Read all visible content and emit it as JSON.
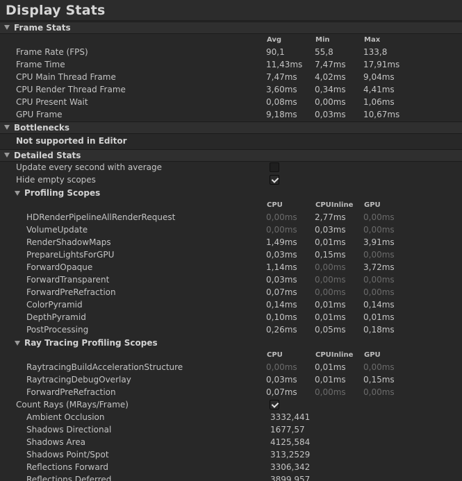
{
  "window_title": "Display Stats",
  "frame_stats": {
    "header": "Frame Stats",
    "columns": [
      "Avg",
      "Min",
      "Max"
    ],
    "rows": [
      {
        "name": "Frame Rate (FPS)",
        "avg": "90,1",
        "min": "55,8",
        "max": "133,8"
      },
      {
        "name": "Frame Time",
        "avg": "11,43ms",
        "min": "7,47ms",
        "max": "17,91ms"
      },
      {
        "name": "CPU Main Thread Frame",
        "avg": "7,47ms",
        "min": "4,02ms",
        "max": "9,04ms"
      },
      {
        "name": "CPU Render Thread Frame",
        "avg": "3,60ms",
        "min": "0,34ms",
        "max": "4,41ms"
      },
      {
        "name": "CPU Present Wait",
        "avg": "0,08ms",
        "min": "0,00ms",
        "max": "1,06ms"
      },
      {
        "name": "GPU Frame",
        "avg": "9,18ms",
        "min": "0,03ms",
        "max": "10,67ms"
      }
    ]
  },
  "bottlenecks": {
    "header": "Bottlenecks",
    "message": "Not supported in Editor"
  },
  "detailed_stats": {
    "header": "Detailed Stats",
    "update_every_second": {
      "label": "Update every second with average",
      "checked": false
    },
    "hide_empty_scopes": {
      "label": "Hide empty scopes",
      "checked": true
    },
    "profiling_scopes": {
      "header": "Profiling Scopes",
      "columns": [
        "CPU",
        "CPUInline",
        "GPU"
      ],
      "rows": [
        {
          "name": "HDRenderPipelineAllRenderRequest",
          "cpu": "0,00ms",
          "cpuinline": "2,77ms",
          "gpu": "0,00ms"
        },
        {
          "name": "VolumeUpdate",
          "cpu": "0,00ms",
          "cpuinline": "0,03ms",
          "gpu": "0,00ms"
        },
        {
          "name": "RenderShadowMaps",
          "cpu": "1,49ms",
          "cpuinline": "0,01ms",
          "gpu": "3,91ms"
        },
        {
          "name": "PrepareLightsForGPU",
          "cpu": "0,03ms",
          "cpuinline": "0,15ms",
          "gpu": "0,00ms"
        },
        {
          "name": "ForwardOpaque",
          "cpu": "1,14ms",
          "cpuinline": "0,00ms",
          "gpu": "3,72ms"
        },
        {
          "name": "ForwardTransparent",
          "cpu": "0,03ms",
          "cpuinline": "0,00ms",
          "gpu": "0,00ms"
        },
        {
          "name": "ForwardPreRefraction",
          "cpu": "0,07ms",
          "cpuinline": "0,00ms",
          "gpu": "0,00ms"
        },
        {
          "name": "ColorPyramid",
          "cpu": "0,14ms",
          "cpuinline": "0,01ms",
          "gpu": "0,14ms"
        },
        {
          "name": "DepthPyramid",
          "cpu": "0,10ms",
          "cpuinline": "0,01ms",
          "gpu": "0,01ms"
        },
        {
          "name": "PostProcessing",
          "cpu": "0,26ms",
          "cpuinline": "0,05ms",
          "gpu": "0,18ms"
        }
      ]
    },
    "ray_tracing_scopes": {
      "header": "Ray Tracing Profiling Scopes",
      "columns": [
        "CPU",
        "CPUInline",
        "GPU"
      ],
      "rows": [
        {
          "name": "RaytracingBuildAccelerationStructure",
          "cpu": "0,00ms",
          "cpuinline": "0,01ms",
          "gpu": "0,00ms"
        },
        {
          "name": "RaytracingDebugOverlay",
          "cpu": "0,03ms",
          "cpuinline": "0,01ms",
          "gpu": "0,15ms"
        },
        {
          "name": "ForwardPreRefraction",
          "cpu": "0,07ms",
          "cpuinline": "0,00ms",
          "gpu": "0,00ms"
        }
      ]
    },
    "count_rays": {
      "label": "Count Rays (MRays/Frame)",
      "checked": true,
      "rows": [
        {
          "name": "Ambient Occlusion",
          "value": "3332,441"
        },
        {
          "name": "Shadows Directional",
          "value": "1677,57"
        },
        {
          "name": "Shadows Area",
          "value": "4125,584"
        },
        {
          "name": "Shadows Point/Spot",
          "value": "313,2529"
        },
        {
          "name": "Reflections Forward",
          "value": "3306,342"
        },
        {
          "name": "Reflections Deferred",
          "value": "3899,957"
        }
      ]
    }
  },
  "colors": {
    "background": "#282828",
    "text": "#c4c4c4",
    "dim_text": "#6b6b6b",
    "section_bg": "#2f2f2f"
  }
}
